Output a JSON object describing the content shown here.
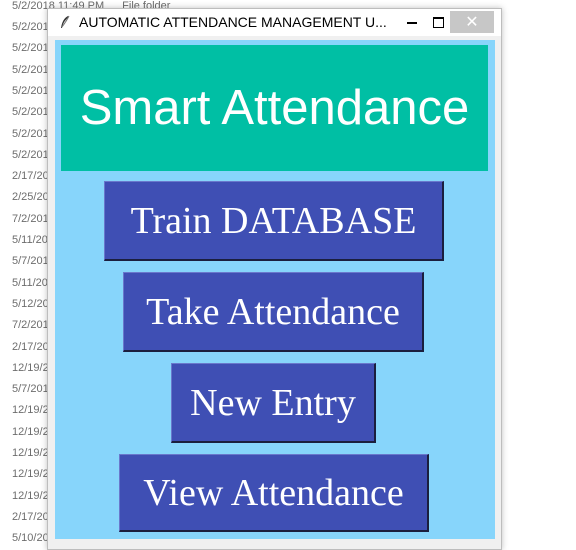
{
  "background": {
    "top_row": {
      "date": "5/2/2018 11:49 PM",
      "type": "File folder"
    },
    "dates": [
      "5/2/201",
      "5/2/201",
      "5/2/201",
      "5/2/201",
      "5/2/201",
      "5/2/201",
      "5/2/201",
      "2/17/20",
      "2/25/20",
      "7/2/201",
      "5/11/20",
      "5/7/201",
      "5/11/20",
      "5/12/20",
      "7/2/201",
      "2/17/20",
      "12/19/2",
      "5/7/201",
      "12/19/2",
      "12/19/2",
      "12/19/2",
      "12/19/2",
      "12/19/2",
      "2/17/20",
      "5/10/20"
    ]
  },
  "window": {
    "title": "AUTOMATIC ATTENDANCE MANAGEMENT U...",
    "close_glyph": "✕",
    "header_text": "Smart Attendance",
    "buttons": {
      "train": "Train DATABASE",
      "take": "Take Attendance",
      "new_entry": "New Entry",
      "view": "View Attendance"
    }
  },
  "colors": {
    "client_bg": "#87d5fb",
    "header_bg": "#00bfa4",
    "button_bg": "#3f4fb4"
  },
  "icons": [
    "feather-icon",
    "minimize-icon",
    "maximize-icon",
    "close-icon"
  ]
}
